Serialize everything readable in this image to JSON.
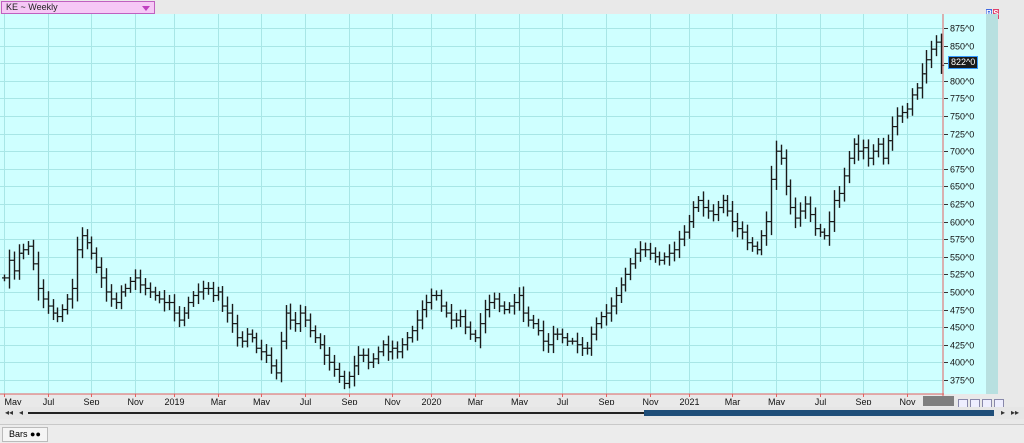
{
  "symbol_selector": {
    "label": "KE ~ Weekly"
  },
  "price_tag": "822^0",
  "bs_labels": [
    "B",
    "S"
  ],
  "status_tab": "Bars",
  "colors": {
    "background": "#cfffff",
    "grid": "#a8e6e6",
    "bars": "#1a1a1a",
    "separator": "#e06060"
  },
  "icons": {
    "scroll_left": "first-icon",
    "scroll_prev": "prev-icon",
    "scroll_next": "next-icon",
    "scroll_last": "last-icon"
  },
  "chart_data": {
    "type": "ohlc",
    "title": "KE ~ Weekly",
    "ylabel": "",
    "xlabel": "",
    "ylim": [
      355,
      895
    ],
    "yticks": [
      "875^0",
      "850^0",
      "825^0",
      "800^0",
      "775^0",
      "750^0",
      "725^0",
      "700^0",
      "675^0",
      "650^0",
      "625^0",
      "600^0",
      "575^0",
      "550^0",
      "525^0",
      "500^0",
      "475^0",
      "450^0",
      "425^0",
      "400^0",
      "375^0"
    ],
    "ytick_values": [
      875,
      850,
      825,
      800,
      775,
      750,
      725,
      700,
      675,
      650,
      625,
      600,
      575,
      550,
      525,
      500,
      475,
      450,
      425,
      400,
      375
    ],
    "x_labels": [
      "May",
      "Jul",
      "Sep",
      "Nov",
      "2019",
      "Mar",
      "May",
      "Jul",
      "Sep",
      "Nov",
      "2020",
      "Mar",
      "May",
      "Jul",
      "Sep",
      "Nov",
      "2021",
      "Mar",
      "May",
      "Jul",
      "Sep",
      "Nov"
    ],
    "x_label_year_flags": [
      false,
      false,
      false,
      false,
      true,
      false,
      false,
      false,
      false,
      false,
      true,
      false,
      false,
      false,
      false,
      false,
      true,
      false,
      false,
      false,
      false,
      false
    ],
    "x_label_week_index": [
      0,
      9,
      18,
      27,
      35,
      44,
      53,
      62,
      71,
      80,
      88,
      97,
      106,
      115,
      124,
      133,
      141,
      150,
      159,
      168,
      177,
      186
    ],
    "closes": [
      520,
      545,
      530,
      555,
      560,
      565,
      540,
      505,
      490,
      480,
      470,
      465,
      475,
      490,
      505,
      560,
      580,
      570,
      555,
      535,
      520,
      500,
      490,
      485,
      500,
      505,
      515,
      520,
      510,
      505,
      500,
      495,
      490,
      485,
      485,
      470,
      460,
      470,
      485,
      495,
      500,
      505,
      505,
      495,
      500,
      480,
      470,
      455,
      435,
      430,
      440,
      435,
      420,
      415,
      410,
      395,
      385,
      430,
      470,
      460,
      455,
      470,
      460,
      445,
      435,
      425,
      410,
      400,
      390,
      380,
      370,
      380,
      395,
      410,
      410,
      400,
      405,
      415,
      425,
      415,
      420,
      415,
      425,
      435,
      445,
      460,
      475,
      485,
      495,
      495,
      480,
      470,
      460,
      460,
      465,
      450,
      440,
      435,
      455,
      475,
      485,
      490,
      480,
      475,
      480,
      485,
      495,
      470,
      460,
      455,
      445,
      430,
      425,
      440,
      440,
      435,
      430,
      430,
      425,
      420,
      420,
      440,
      455,
      465,
      470,
      480,
      495,
      510,
      525,
      540,
      555,
      560,
      560,
      555,
      550,
      545,
      550,
      555,
      560,
      575,
      585,
      600,
      620,
      630,
      620,
      615,
      610,
      620,
      630,
      615,
      600,
      590,
      585,
      570,
      565,
      560,
      580,
      600,
      660,
      700,
      690,
      650,
      620,
      605,
      615,
      625,
      610,
      590,
      585,
      580,
      600,
      630,
      640,
      665,
      690,
      710,
      700,
      705,
      690,
      700,
      710,
      690,
      715,
      735,
      750,
      755,
      760,
      780,
      790,
      810,
      830,
      845,
      855,
      822
    ]
  }
}
